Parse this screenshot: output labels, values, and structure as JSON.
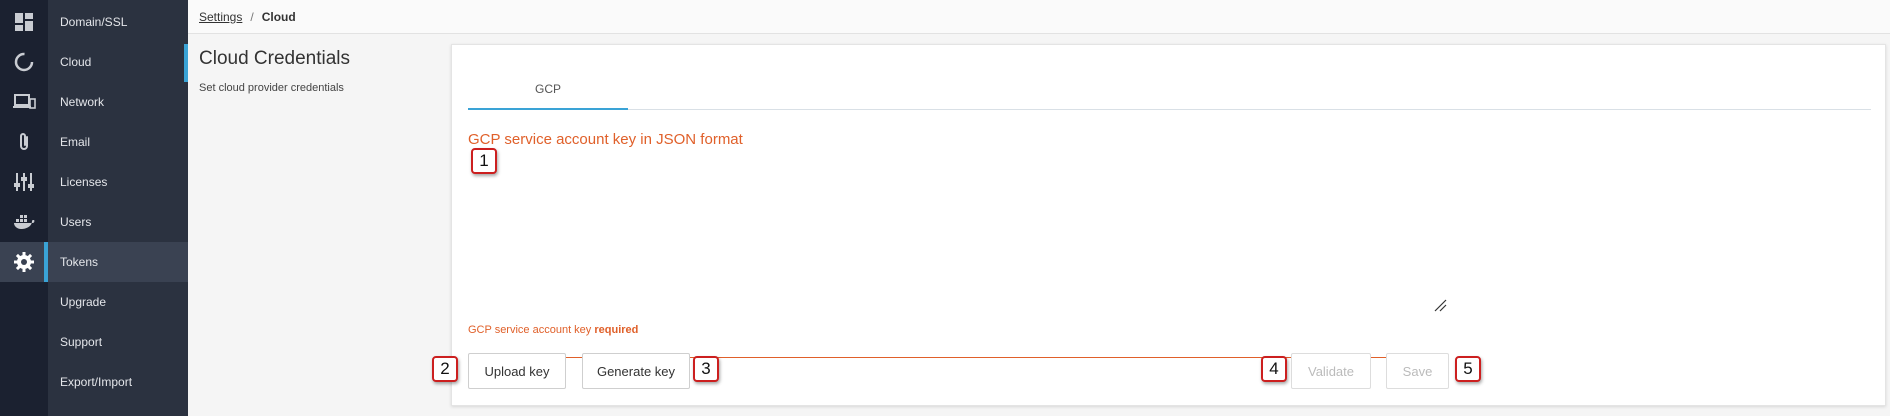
{
  "rail": {
    "icons": [
      "dashboard-icon",
      "refresh-icon",
      "devices-icon",
      "paperclip-icon",
      "sliders-icon",
      "docker-icon",
      "gear-icon"
    ],
    "active_icon": "gear-icon"
  },
  "sidebar": {
    "items": [
      {
        "label": "Domain/SSL"
      },
      {
        "label": "Cloud"
      },
      {
        "label": "Network"
      },
      {
        "label": "Email"
      },
      {
        "label": "Licenses"
      },
      {
        "label": "Users"
      },
      {
        "label": "Tokens"
      },
      {
        "label": "Upgrade"
      },
      {
        "label": "Support"
      },
      {
        "label": "Export/Import"
      }
    ],
    "active": "Tokens"
  },
  "breadcrumb": {
    "parent": "Settings",
    "separator": "/",
    "current": "Cloud"
  },
  "page": {
    "title": "Cloud Credentials",
    "subtitle": "Set cloud provider credentials"
  },
  "card": {
    "tabs": [
      {
        "label": "GCP"
      }
    ],
    "field_label": "GCP service account key in JSON format",
    "textarea_value": "",
    "error_prefix": "GCP service account key",
    "error_strong": "required",
    "buttons": {
      "upload": "Upload key",
      "generate": "Generate key",
      "validate": "Validate",
      "save": "Save"
    }
  },
  "badges": [
    "1",
    "2",
    "3",
    "4",
    "5"
  ],
  "colors": {
    "rail_bg": "#1b2130",
    "sidebar_bg": "#2b3240",
    "accent": "#3aa3d6",
    "error": "#e0602a",
    "badge_border": "#cc1f1f"
  }
}
